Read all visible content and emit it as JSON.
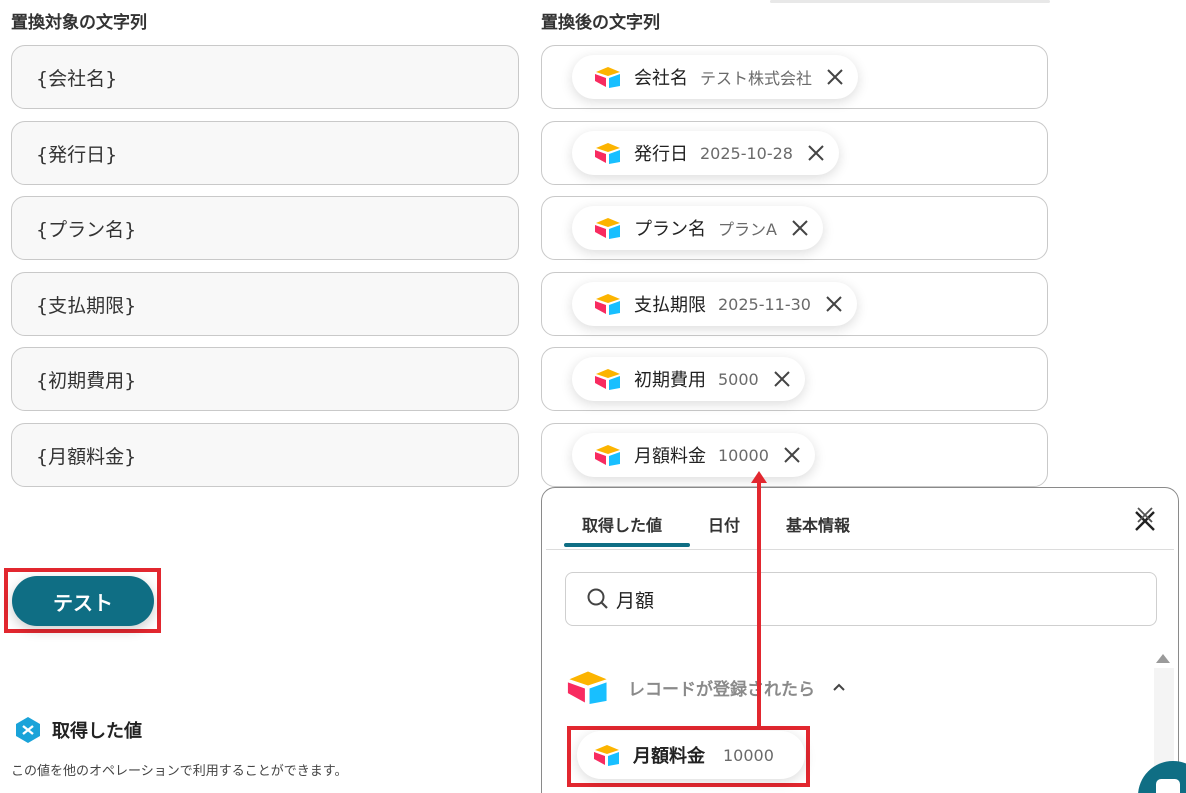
{
  "headers": {
    "left": "置換対象の文字列",
    "right": "置換後の文字列"
  },
  "rows": [
    {
      "target": "{会社名}",
      "name": "会社名",
      "value": "テスト株式会社"
    },
    {
      "target": "{発行日}",
      "name": "発行日",
      "value": "2025-10-28"
    },
    {
      "target": "{プラン名}",
      "name": "プラン名",
      "value": "プランA"
    },
    {
      "target": "{支払期限}",
      "name": "支払期限",
      "value": "2025-11-30"
    },
    {
      "target": "{初期費用}",
      "name": "初期費用",
      "value": "5000"
    },
    {
      "target": "{月額料金}",
      "name": "月額料金",
      "value": "10000"
    }
  ],
  "test_button": "テスト",
  "acquired": {
    "title": "取得した値",
    "description": "この値を他のオペレーションで利用することができます。"
  },
  "panel": {
    "tabs": [
      "取得した値",
      "日付",
      "基本情報"
    ],
    "active_tab": 0,
    "search": {
      "value": "月額"
    },
    "group_label": "レコードが登録されたら",
    "result": {
      "name": "月額料金",
      "value": "10000"
    }
  },
  "colors": {
    "accent": "#0f6e84",
    "highlight": "#e2272f"
  },
  "icons": {
    "app": "airtable-logo-icon",
    "remove": "close-icon",
    "search": "search-icon",
    "expand": "chevron-up-icon"
  }
}
